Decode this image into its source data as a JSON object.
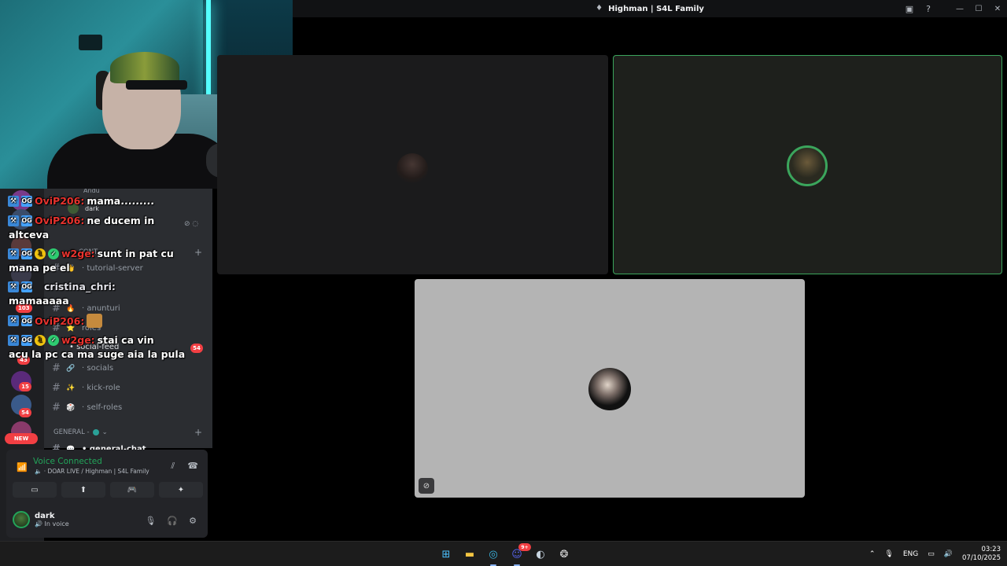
{
  "window": {
    "title": "Highman | S4L Family",
    "controls": [
      "minimize",
      "maximize",
      "close"
    ]
  },
  "sidebar": {
    "top_partial": {
      "label1": "Andu",
      "label2": "dark"
    },
    "badges": [
      "103",
      "43",
      "15",
      "54",
      "54"
    ],
    "new_label": "NEW",
    "channels": [
      {
        "emoji": "👋",
        "label": "tutorial-server"
      },
      {
        "emoji": "🔥",
        "label": "anunturi"
      },
      {
        "emoji": "⭐",
        "label": "roles"
      },
      {
        "emoji": "🔗",
        "label": "socials"
      },
      {
        "emoji": "✨",
        "label": "kick-role"
      },
      {
        "emoji": "🎲",
        "label": "self-roles"
      }
    ],
    "social_feed_label": "social-feed",
    "category_general": "GENERAL -",
    "general_chat": "general-chat",
    "category_cont": "CONT"
  },
  "voice": {
    "status": "Voice Connected",
    "channel": "DOAR LIVE / Highman | S4L Family",
    "user_name": "dark",
    "user_status": "In voice"
  },
  "chat": [
    {
      "user": "OviP206:",
      "text": "mama.........",
      "user_color": "#e8332e"
    },
    {
      "user": "OviP206:",
      "text": "ne ducem in",
      "cont": "altceva",
      "user_color": "#e8332e"
    },
    {
      "user": "w2ge:",
      "text": "sunt in pat cu",
      "cont": "mana pe el",
      "user_color": "#e8332e"
    },
    {
      "user": "cristina_chri:",
      "text": "",
      "cont": "mamaaaaa",
      "user_color": "#e3e3ea"
    },
    {
      "user": "OviP206:",
      "text": "",
      "user_color": "#e8332e"
    },
    {
      "user": "w2ge:",
      "text": "stai ca vin",
      "cont": "acu la pc ca ma suge aia la pula",
      "user_color": "#e8332e"
    }
  ],
  "taskbar": {
    "discord_badge": "9+",
    "lang": "ENG",
    "time": "03:23",
    "date": "07/10/2025"
  }
}
